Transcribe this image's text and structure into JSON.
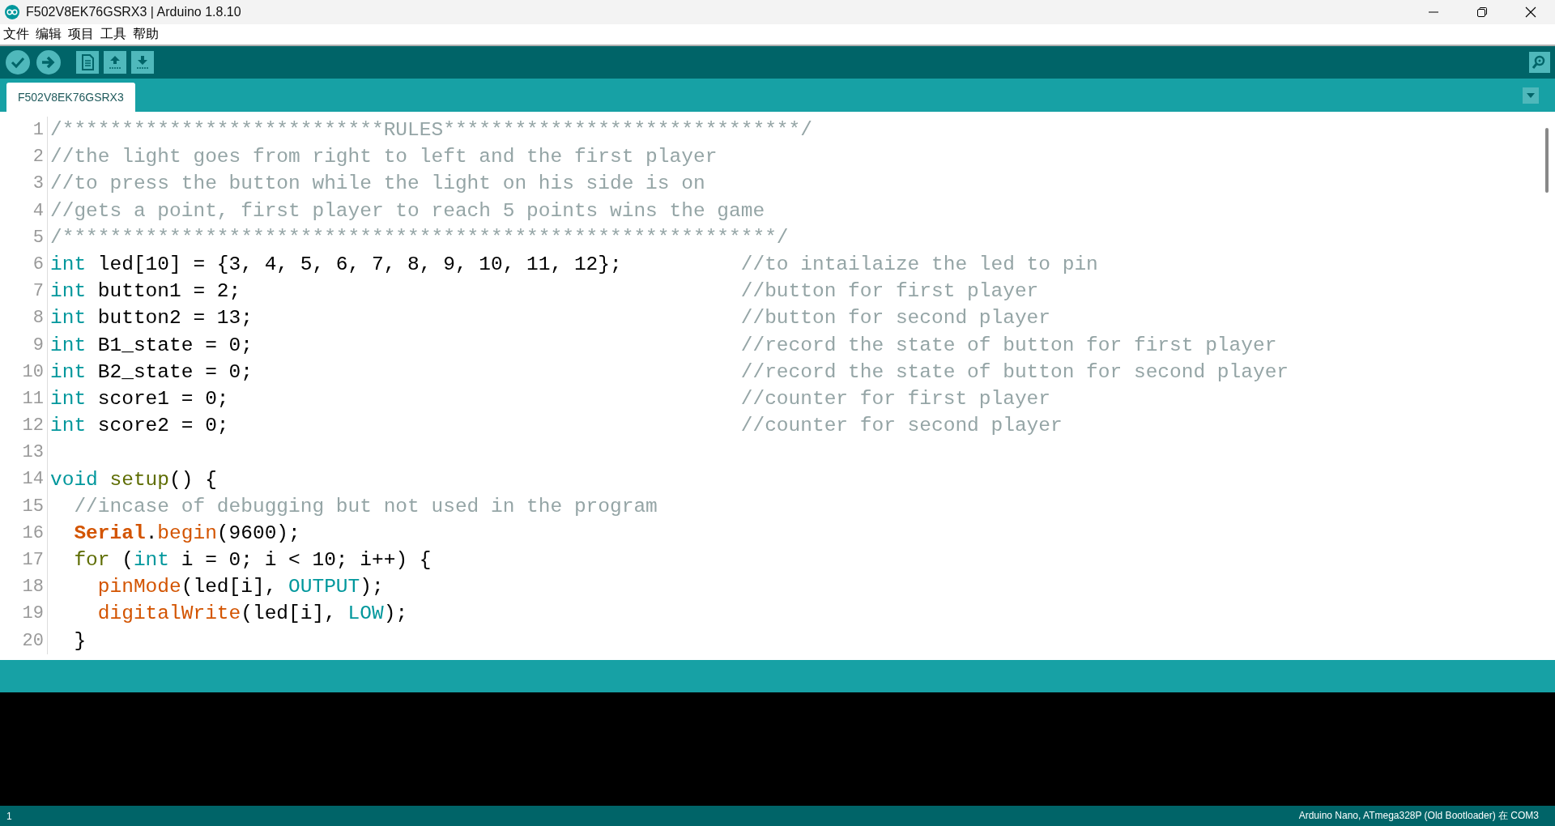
{
  "window": {
    "title": "F502V8EK76GSRX3 | Arduino 1.8.10"
  },
  "menu": [
    "文件",
    "编辑",
    "项目",
    "工具",
    "帮助"
  ],
  "tabs": [
    {
      "label": "F502V8EK76GSRX3",
      "selected": true
    }
  ],
  "editor": {
    "lines": [
      {
        "number": "1",
        "tokens": [
          {
            "kind": "comment",
            "text": "/***************************RULES******************************/"
          }
        ]
      },
      {
        "number": "2",
        "tokens": [
          {
            "kind": "comment",
            "text": "//the light goes from right to left and the first player"
          }
        ]
      },
      {
        "number": "3",
        "tokens": [
          {
            "kind": "comment",
            "text": "//to press the button while the light on his side is on"
          }
        ]
      },
      {
        "number": "4",
        "tokens": [
          {
            "kind": "comment",
            "text": "//gets a point, first player to reach 5 points wins the game"
          }
        ]
      },
      {
        "number": "5",
        "tokens": [
          {
            "kind": "comment",
            "text": "/************************************************************/"
          }
        ]
      },
      {
        "number": "6",
        "tokens": [
          {
            "kind": "type",
            "text": "int"
          },
          {
            "kind": "plain",
            "text": " led[10] = {3, 4, 5, 6, 7, 8, 9, 10, 11, 12};          "
          },
          {
            "kind": "comment",
            "text": "//to intailaize the led to pin"
          }
        ]
      },
      {
        "number": "7",
        "tokens": [
          {
            "kind": "type",
            "text": "int"
          },
          {
            "kind": "plain",
            "text": " button1 = 2;                                          "
          },
          {
            "kind": "comment",
            "text": "//button for first player"
          }
        ]
      },
      {
        "number": "8",
        "tokens": [
          {
            "kind": "type",
            "text": "int"
          },
          {
            "kind": "plain",
            "text": " button2 = 13;                                         "
          },
          {
            "kind": "comment",
            "text": "//button for second player"
          }
        ]
      },
      {
        "number": "9",
        "tokens": [
          {
            "kind": "type",
            "text": "int"
          },
          {
            "kind": "plain",
            "text": " B1_state = 0;                                         "
          },
          {
            "kind": "comment",
            "text": "//record the state of button for first player"
          }
        ]
      },
      {
        "number": "10",
        "tokens": [
          {
            "kind": "type",
            "text": "int"
          },
          {
            "kind": "plain",
            "text": " B2_state = 0;                                         "
          },
          {
            "kind": "comment",
            "text": "//record the state of button for second player"
          }
        ]
      },
      {
        "number": "11",
        "tokens": [
          {
            "kind": "type",
            "text": "int"
          },
          {
            "kind": "plain",
            "text": " score1 = 0;                                           "
          },
          {
            "kind": "comment",
            "text": "//counter for first player"
          }
        ]
      },
      {
        "number": "12",
        "tokens": [
          {
            "kind": "type",
            "text": "int"
          },
          {
            "kind": "plain",
            "text": " score2 = 0;                                           "
          },
          {
            "kind": "comment",
            "text": "//counter for second player"
          }
        ]
      },
      {
        "number": "13"
      },
      {
        "number": "14",
        "tokens": [
          {
            "kind": "type",
            "text": "void "
          },
          {
            "kind": "keyword",
            "text": "setup"
          },
          {
            "kind": "plain",
            "text": "() {"
          }
        ]
      },
      {
        "number": "15",
        "tokens": [
          {
            "kind": "comment",
            "text": "  //incase of debugging but not used in the program"
          }
        ]
      },
      {
        "number": "16",
        "tokens": [
          {
            "kind": "class",
            "text": "  Serial"
          },
          {
            "kind": "plain",
            "text": "."
          },
          {
            "kind": "function",
            "text": "begin"
          },
          {
            "kind": "plain",
            "text": "(9600);"
          }
        ]
      },
      {
        "number": "17",
        "tokens": [
          {
            "kind": "keyword",
            "text": "  for"
          },
          {
            "kind": "plain",
            "text": " ("
          },
          {
            "kind": "type",
            "text": "int"
          },
          {
            "kind": "plain",
            "text": " i = 0; i < 10; i++) {"
          }
        ]
      },
      {
        "number": "18",
        "tokens": [
          {
            "kind": "function",
            "text": "    pinMode"
          },
          {
            "kind": "plain",
            "text": "(led[i], "
          },
          {
            "kind": "constant",
            "text": "OUTPUT"
          },
          {
            "kind": "plain",
            "text": ");"
          }
        ]
      },
      {
        "number": "19",
        "tokens": [
          {
            "kind": "function",
            "text": "    digitalWrite"
          },
          {
            "kind": "plain",
            "text": "(led[i], "
          },
          {
            "kind": "constant",
            "text": "LOW"
          },
          {
            "kind": "plain",
            "text": ");"
          }
        ]
      },
      {
        "number": "20",
        "tokens": [
          {
            "kind": "plain",
            "text": "  }"
          }
        ]
      }
    ]
  },
  "status_bar": {
    "line": "1",
    "board": "Arduino Nano, ATmega328P (Old Bootloader) 在 COM3"
  }
}
